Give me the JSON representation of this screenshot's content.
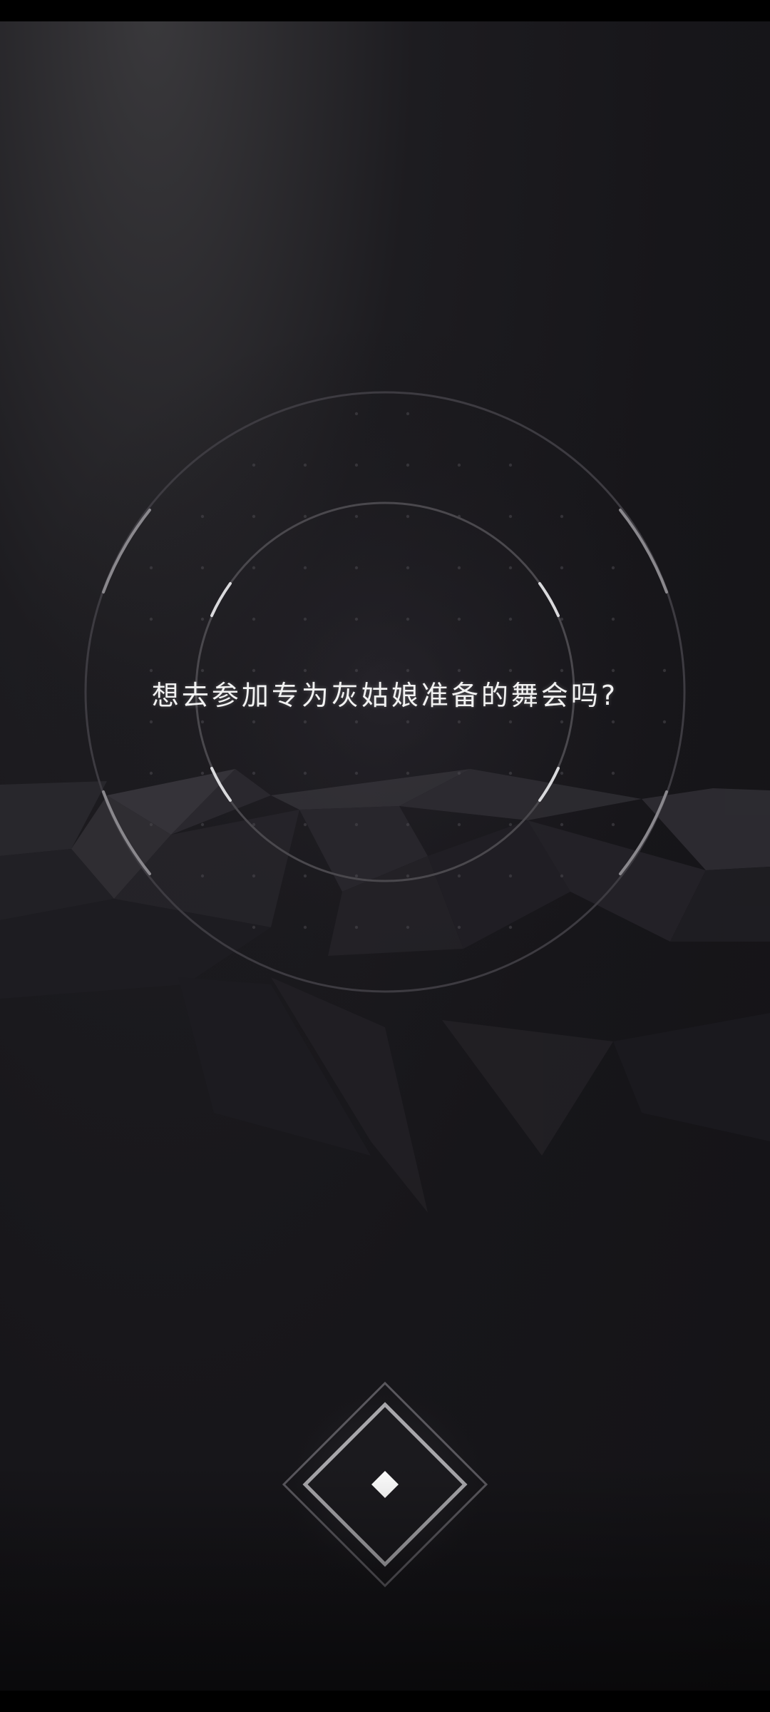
{
  "dialog": {
    "prompt": "想去参加专为灰姑娘准备的舞会吗?"
  },
  "controls": {
    "start_button_icon": "diamond-icon"
  },
  "colors": {
    "background": "#17161a",
    "text": "#f2f2f2",
    "ring": "#4a484d",
    "accent": "#ffffff"
  }
}
